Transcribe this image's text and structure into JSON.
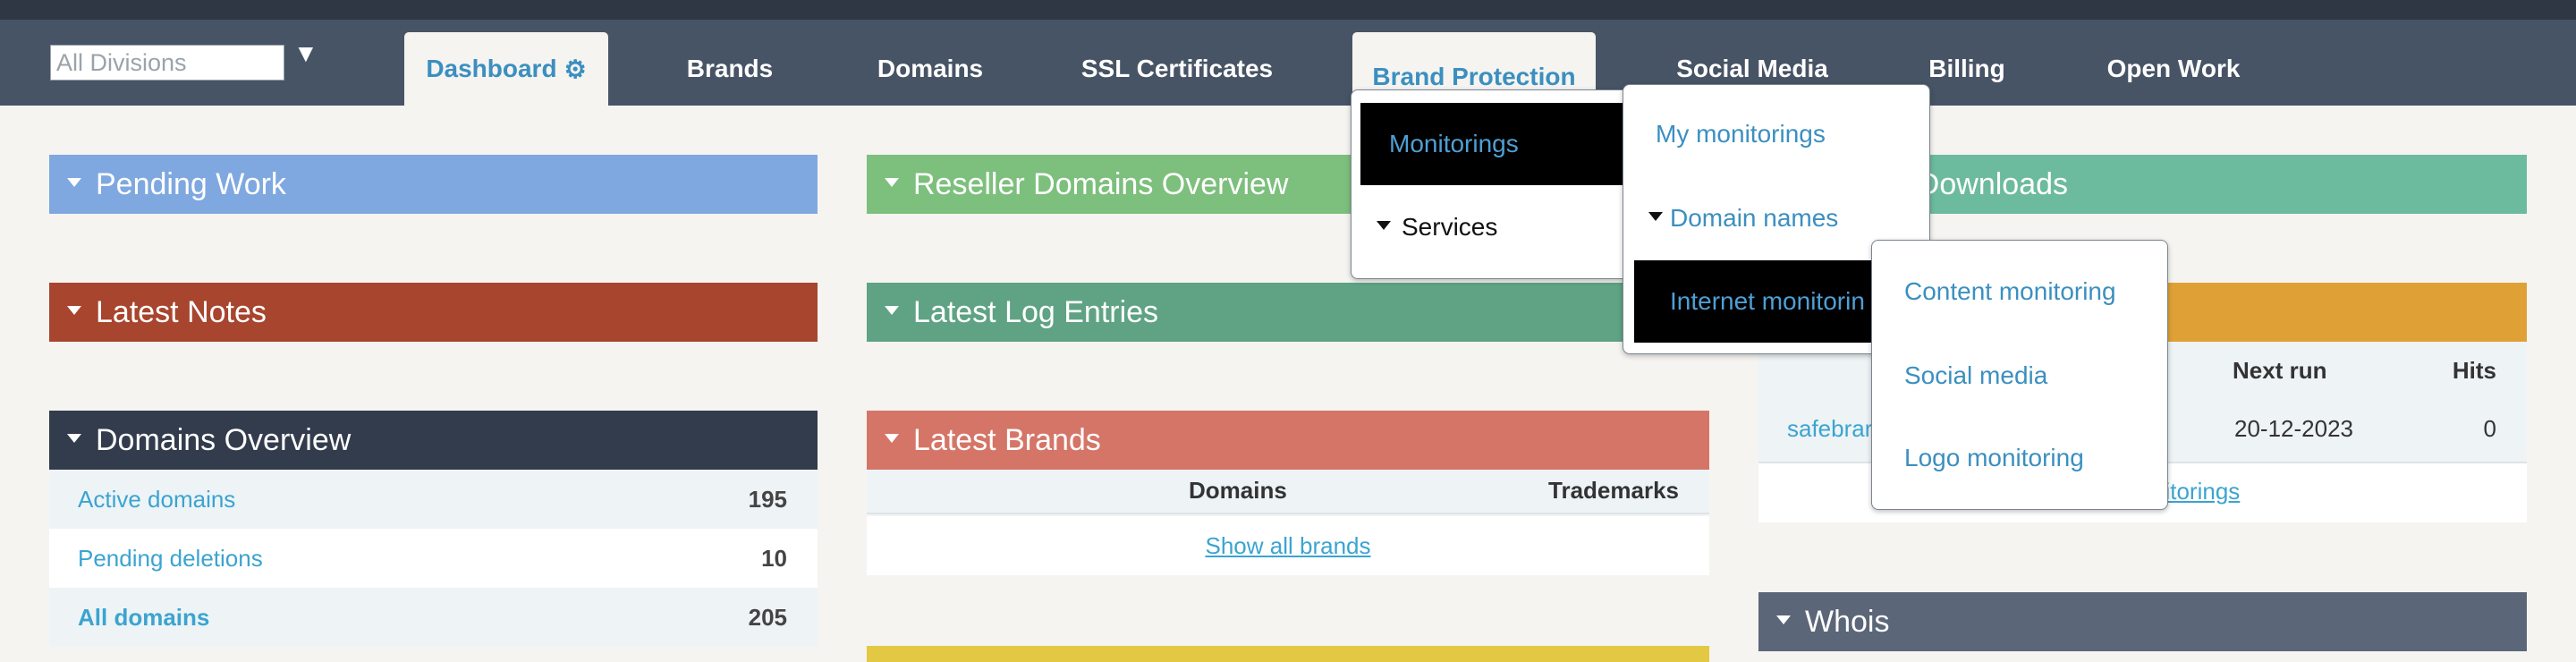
{
  "nav": {
    "division_placeholder": "All Divisions",
    "division_arrow": "▼",
    "tabs": [
      {
        "label": "Dashboard"
      },
      {
        "label": "Brands"
      },
      {
        "label": "Domains"
      },
      {
        "label": "SSL Certificates"
      },
      {
        "label": "Brand Protection"
      },
      {
        "label": "Social Media"
      },
      {
        "label": "Billing"
      },
      {
        "label": "Open Work"
      }
    ]
  },
  "panels": {
    "pending_work": "Pending Work",
    "latest_notes": "Latest Notes",
    "domains_overview": {
      "title": "Domains Overview",
      "rows": [
        {
          "label": "Active domains",
          "value": "195"
        },
        {
          "label": "Pending deletions",
          "value": "10"
        },
        {
          "label": "All domains",
          "value": "205"
        }
      ]
    },
    "reseller_domains": "Reseller Domains Overview",
    "latest_log": "Latest Log Entries",
    "latest_brands": {
      "title": "Latest Brands",
      "col_domains": "Domains",
      "col_trademarks": "Trademarks",
      "show_all": "Show all brands"
    },
    "downloads_partial": "nt Downloads",
    "monitorings_table": {
      "col_next_run": "Next run",
      "col_hits": "Hits",
      "row_name_partial": "safebrar",
      "row_next_run": "20-12-2023",
      "row_hits": "0",
      "link_partial": "nitorings"
    },
    "whois": "Whois"
  },
  "menus": {
    "level1": {
      "monitorings": "Monitorings",
      "services": "Services"
    },
    "level2": {
      "my_monitorings": "My monitorings",
      "domain_names": "Domain names",
      "internet_monitoring": "Internet monitorin"
    },
    "level3": {
      "content_monitoring": "Content monitoring",
      "social_media": "Social media",
      "logo_monitoring": "Logo monitoring"
    }
  },
  "colors": {
    "pending_work": "#7fa8e0",
    "latest_notes": "#a8452e",
    "domains_overview": "#333c4c",
    "reseller": "#7dbf7d",
    "latest_log": "#5fa384",
    "latest_brands": "#d57567",
    "downloads": "#6dbb9e",
    "orange": "#dfa135",
    "whois": "#5b6678",
    "yellow": "#e3c843"
  }
}
